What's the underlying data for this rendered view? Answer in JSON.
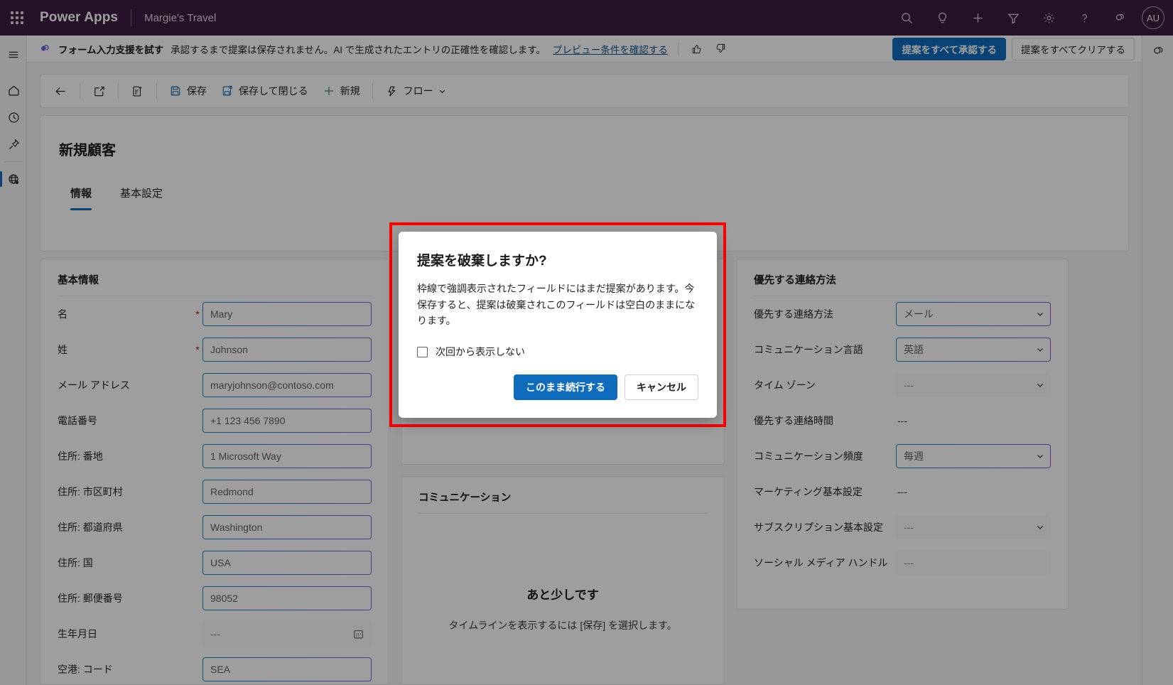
{
  "suite": {
    "brand": "Power Apps",
    "environment": "Margie's Travel",
    "avatar_initials": "AU",
    "icons": [
      "waffle-icon",
      "search-icon",
      "lightbulb-icon",
      "plus-icon",
      "filter-icon",
      "gear-icon",
      "help-icon",
      "copilot-icon"
    ]
  },
  "rail": {
    "items": [
      {
        "name": "menu-icon",
        "label": ""
      },
      {
        "name": "home-icon",
        "label": ""
      },
      {
        "name": "recent-icon",
        "label": ""
      },
      {
        "name": "pinned-icon",
        "label": ""
      },
      {
        "name": "globe-icon",
        "label": ""
      }
    ]
  },
  "banner": {
    "title": "フォーム入力支援を試す",
    "message": "承認するまで提案は保存されません。AI で生成されたエントリの正確性を確認します。",
    "link": "プレビュー条件を確認する",
    "approve_all": "提案をすべて承認する",
    "clear_all": "提案をすべてクリアする"
  },
  "commandbar": {
    "back": "",
    "popout": "",
    "formfill": "",
    "save": "保存",
    "save_and_close": "保存して閉じる",
    "new": "新規",
    "flow": "フロー"
  },
  "form": {
    "title": "新規顧客",
    "tabs": [
      {
        "label": "情報",
        "active": true
      },
      {
        "label": "基本設定",
        "active": false
      }
    ]
  },
  "left_section": {
    "title": "基本情報",
    "fields": [
      {
        "label": "名",
        "required": true,
        "value": "Mary",
        "state": "suggest",
        "control": "text"
      },
      {
        "label": "姓",
        "required": true,
        "value": "Johnson",
        "state": "suggest",
        "control": "text"
      },
      {
        "label": "メール アドレス",
        "required": false,
        "value": "maryjohnson@contoso.com",
        "state": "suggest",
        "control": "text"
      },
      {
        "label": "電話番号",
        "required": false,
        "value": "+1 123 456 7890",
        "state": "suggest",
        "control": "text"
      },
      {
        "label": "住所: 番地",
        "required": false,
        "value": "1 Microsoft Way",
        "state": "suggest",
        "control": "text"
      },
      {
        "label": "住所: 市区町村",
        "required": false,
        "value": "Redmond",
        "state": "suggest",
        "control": "text"
      },
      {
        "label": "住所: 都道府県",
        "required": false,
        "value": "Washington",
        "state": "suggest",
        "control": "text"
      },
      {
        "label": "住所: 国",
        "required": false,
        "value": "USA",
        "state": "suggest",
        "control": "text"
      },
      {
        "label": "住所: 郵便番号",
        "required": false,
        "value": "98052",
        "state": "suggest",
        "control": "text"
      },
      {
        "label": "生年月日",
        "required": false,
        "value": "---",
        "state": "empty",
        "control": "date"
      },
      {
        "label": "空港: コード",
        "required": false,
        "value": "SEA",
        "state": "suggest",
        "control": "text"
      }
    ]
  },
  "mid_section": {
    "title": "コミュニケーション",
    "empty_title": "あと少しです",
    "empty_sub": "タイムラインを表示するには [保存] を選択します。"
  },
  "right_section": {
    "title": "優先する連絡方法",
    "fields": [
      {
        "label": "優先する連絡方法",
        "value": "メール",
        "state": "suggest",
        "control": "select"
      },
      {
        "label": "コミュニケーション言語",
        "value": "英語",
        "state": "suggest",
        "control": "select"
      },
      {
        "label": "タイム ゾーン",
        "value": "---",
        "state": "empty",
        "control": "select"
      },
      {
        "label": "優先する連絡時間",
        "value": "---",
        "state": "static",
        "control": "static"
      },
      {
        "label": "コミュニケーション頻度",
        "value": "毎週",
        "state": "suggest",
        "control": "select"
      },
      {
        "label": "マーケティング基本設定",
        "value": "---",
        "state": "static",
        "control": "static"
      },
      {
        "label": "サブスクリプション基本設定",
        "value": "---",
        "state": "empty",
        "control": "select"
      },
      {
        "label": "ソーシャル メディア ハンドル",
        "value": "---",
        "state": "empty",
        "control": "select"
      }
    ]
  },
  "dialog": {
    "title": "提案を破棄しますか?",
    "body": "枠線で強調表示されたフィールドにはまだ提案があります。今保存すると、提案は破棄されこのフィールドは空白のままになります。",
    "checkbox_label": "次回から表示しない",
    "primary": "このまま続行する",
    "secondary": "キャンセル",
    "highlight_color": "#ff0000"
  },
  "colors": {
    "suitebar": "#3b1a3f",
    "accent": "#0f6cbd",
    "required": "#b10e1c"
  }
}
